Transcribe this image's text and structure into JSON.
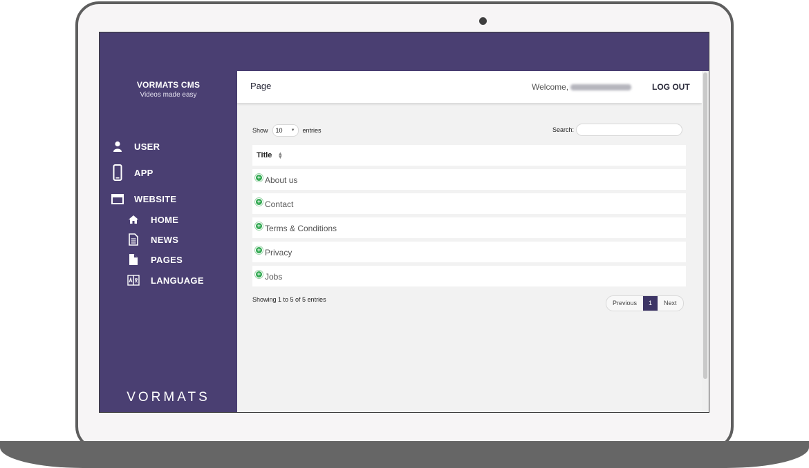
{
  "brand": {
    "title": "VORMATS CMS",
    "subtitle": "Videos made easy",
    "logo_text": "VORMATS"
  },
  "sidebar": {
    "items": [
      {
        "label": "USER",
        "icon": "user-icon"
      },
      {
        "label": "APP",
        "icon": "phone-icon"
      },
      {
        "label": "WEBSITE",
        "icon": "browser-window-icon"
      }
    ],
    "sub_items": [
      {
        "label": "HOME",
        "icon": "home-icon"
      },
      {
        "label": "NEWS",
        "icon": "document-lines-icon"
      },
      {
        "label": "PAGES",
        "icon": "file-icon"
      },
      {
        "label": "LANGUAGE",
        "icon": "translate-icon"
      }
    ]
  },
  "header": {
    "page_title": "Page",
    "welcome": "Welcome,",
    "logout": "LOG OUT"
  },
  "table_controls": {
    "show_label": "Show",
    "page_length": "10",
    "entries_label": "entries",
    "search_label": "Search:",
    "search_value": ""
  },
  "table": {
    "column_title": "Title",
    "rows": [
      "About us",
      "Contact",
      "Terms & Conditions",
      "Privacy",
      "Jobs"
    ]
  },
  "footer": {
    "info": "Showing 1 to 5 of 5 entries",
    "previous": "Previous",
    "current_page": "1",
    "next": "Next"
  },
  "colors": {
    "sidebar_bg": "#4a3f72",
    "active_page": "#3d3566",
    "expand_icon": "#2fa84f"
  }
}
